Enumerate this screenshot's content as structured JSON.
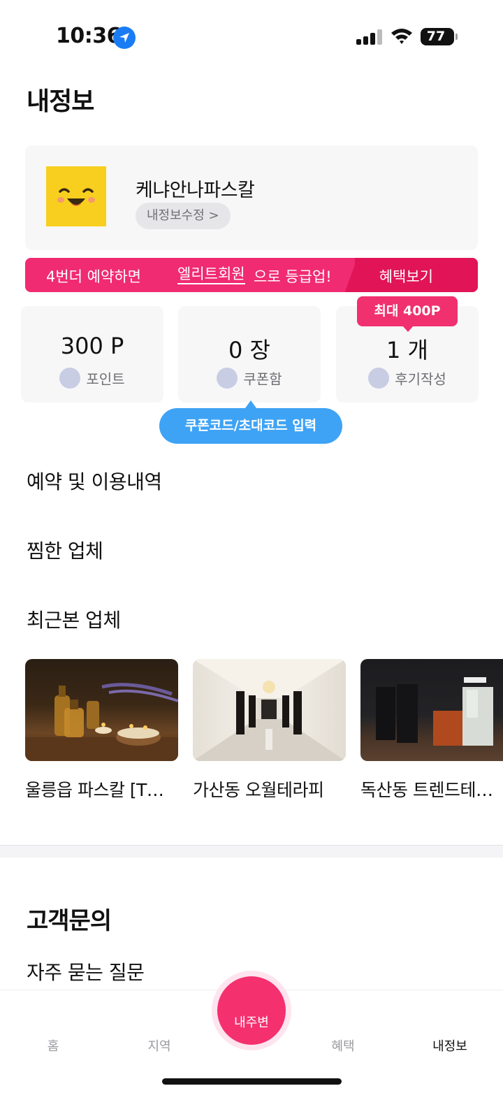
{
  "status": {
    "time": "10:36",
    "battery": "77"
  },
  "page": {
    "title": "내정보"
  },
  "profile": {
    "name": "케냐안나파스칼",
    "edit_label": "내정보수정 >"
  },
  "promo": {
    "text_before": "4번더 예약하면",
    "highlight": "엘리트회원",
    "text_after": "으로 등급업!",
    "benefit_link": "혜택보기"
  },
  "stats": [
    {
      "value": "300 P",
      "label": "포인트"
    },
    {
      "value": "0 장",
      "label": "쿠폰함"
    },
    {
      "value": "1 개",
      "label": "후기작성"
    }
  ],
  "tooltips": {
    "review_bonus": "최대 400P",
    "coupon_code": "쿠폰코드/초대코드 입력"
  },
  "menu": {
    "reservations": "예약 및 이용내역",
    "favorites": "찜한 업체",
    "recent": "최근본 업체"
  },
  "recent_places": [
    {
      "name": "울릉읍 파스칼 [T…",
      "image": "aroma-candles-photo"
    },
    {
      "name": "가산동 오월테라피",
      "image": "white-hallway-photo"
    },
    {
      "name": "독산동 트렌드테…",
      "image": "dark-room-photo"
    }
  ],
  "support": {
    "title": "고객문의",
    "faq": "자주 묻는 질문"
  },
  "bottom_nav": {
    "home": "홈",
    "region": "지역",
    "nearby": "내주변",
    "benefits": "혜택",
    "my_info": "내정보",
    "active": "my_info"
  },
  "colors": {
    "brand_pink": "#f02b71",
    "accent_blue": "#3ea3f5",
    "avatar_yellow": "#f8cf1e"
  }
}
